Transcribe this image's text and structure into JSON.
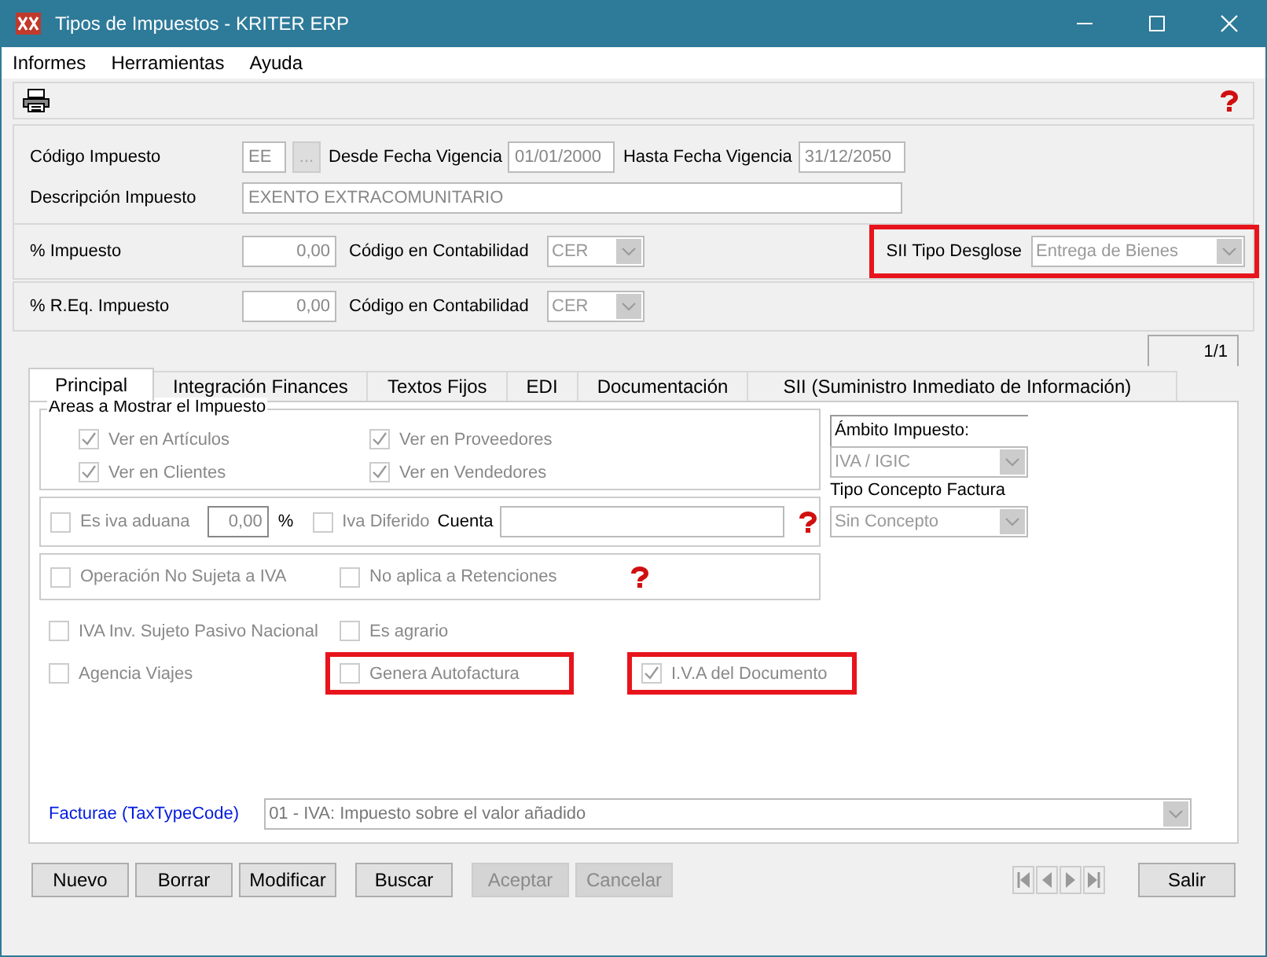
{
  "window": {
    "title": "Tipos de Impuestos - KRITER ERP"
  },
  "menu": [
    "Informes",
    "Herramientas",
    "Ayuda"
  ],
  "header": {
    "codigo": {
      "label": "Código Impuesto",
      "value": "EE",
      "lookup": "..."
    },
    "desde": {
      "label": "Desde Fecha Vigencia",
      "value": "01/01/2000"
    },
    "hasta": {
      "label": "Hasta Fecha Vigencia",
      "value": "31/12/2050"
    },
    "descripcion": {
      "label": "Descripción Impuesto",
      "value": "EXENTO EXTRACOMUNITARIO"
    }
  },
  "impuesto": {
    "label": "% Impuesto",
    "value": "0,00",
    "contab_label": "Código en Contabilidad",
    "contab_value": "CER"
  },
  "sii": {
    "label": "SII Tipo Desglose",
    "value": "Entrega de Bienes",
    "highlighted": true
  },
  "req": {
    "label": "% R.Eq. Impuesto",
    "value": "0,00",
    "contab_label": "Código en Contabilidad",
    "contab_value": "CER"
  },
  "record_counter": "1/1",
  "tabs": [
    {
      "label": "Principal",
      "selected": true
    },
    {
      "label": "Integración Finances",
      "selected": false
    },
    {
      "label": "Textos Fijos",
      "selected": false
    },
    {
      "label": "EDI",
      "selected": false
    },
    {
      "label": "Documentación",
      "selected": false
    },
    {
      "label": "SII (Suministro Inmediato de Información)",
      "selected": false
    }
  ],
  "areas": {
    "title": "Areas a Mostrar el Impuesto",
    "checks": [
      {
        "label": "Ver en Artículos",
        "checked": true
      },
      {
        "label": "Ver en Proveedores",
        "checked": true
      },
      {
        "label": "Ver en Clientes",
        "checked": true
      },
      {
        "label": "Ver en Vendedores",
        "checked": true
      }
    ]
  },
  "aduana": {
    "check": {
      "label": "Es iva aduana",
      "checked": false
    },
    "value": "0,00",
    "unit": "%",
    "diferido": {
      "label": "Iva Diferido",
      "checked": false
    },
    "cuenta_label": "Cuenta"
  },
  "operacion": [
    {
      "label": "Operación No Sujeta a IVA",
      "checked": false
    },
    {
      "label": "No aplica a Retenciones",
      "checked": false
    }
  ],
  "bottom_checks": [
    [
      {
        "label": "IVA Inv. Sujeto Pasivo Nacional",
        "checked": false,
        "highlighted": false
      },
      {
        "label": "Es agrario",
        "checked": false,
        "highlighted": false
      }
    ],
    [
      {
        "label": "Agencia Viajes",
        "checked": false,
        "highlighted": false
      },
      {
        "label": "Genera Autofactura",
        "checked": false,
        "highlighted": true
      },
      {
        "label": "I.V.A del Documento",
        "checked": true,
        "highlighted": true
      }
    ]
  ],
  "ambito": {
    "label": "Ámbito Impuesto:",
    "value": "IVA / IGIC"
  },
  "tipo_concepto": {
    "label": "Tipo Concepto Factura",
    "value": "Sin Concepto"
  },
  "facturae": {
    "label": "Facturae (TaxTypeCode)",
    "value": "01 - IVA: Impuesto sobre el valor añadido"
  },
  "buttons": [
    {
      "label": "Nuevo",
      "disabled": false
    },
    {
      "label": "Borrar",
      "disabled": false
    },
    {
      "label": "Modificar",
      "disabled": false
    },
    {
      "label": "Buscar",
      "disabled": false
    },
    {
      "label": "Aceptar",
      "disabled": true
    },
    {
      "label": "Cancelar",
      "disabled": true
    }
  ],
  "exit_button": "Salir"
}
